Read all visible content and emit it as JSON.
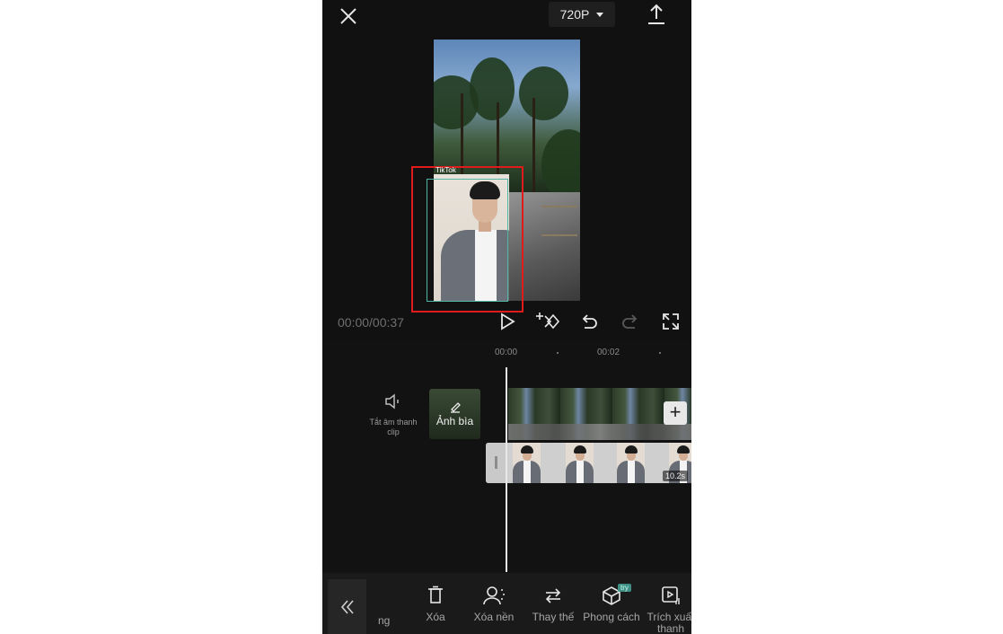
{
  "topbar": {
    "resolution": "720P"
  },
  "preview": {
    "watermark": "TikTok"
  },
  "playback": {
    "timecode": "00:00/00:37"
  },
  "timeline": {
    "ruler": [
      "00:00",
      "00:02"
    ],
    "mute_label": "Tắt âm thanh clip",
    "cover_label": "Ảnh bìa",
    "overlay_duration": "10.2s"
  },
  "toolbar": {
    "partial_left": "ng",
    "items": [
      {
        "label": "Xóa",
        "icon": "trash-icon"
      },
      {
        "label": "Xóa nền",
        "icon": "remove-background-icon"
      },
      {
        "label": "Thay thế",
        "icon": "replace-icon"
      },
      {
        "label": "Phong cách",
        "icon": "cube-style-icon",
        "badge": "try"
      },
      {
        "label": "Trích xuất",
        "label2": "thanh",
        "icon": "extract-audio-icon"
      }
    ]
  },
  "colors": {
    "background": "#111111",
    "selection_red": "#e01b1b",
    "overlay_frame": "#4fb7a3",
    "try_badge": "#3f8f86"
  }
}
